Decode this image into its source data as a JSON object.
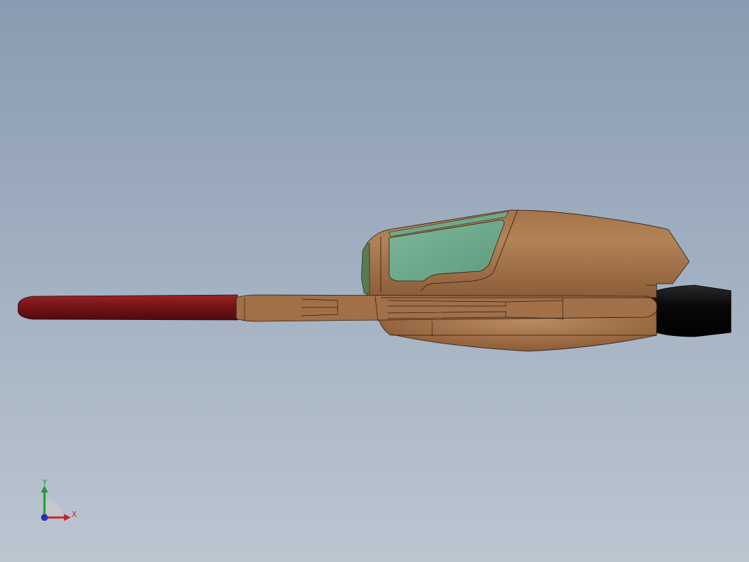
{
  "viewport": {
    "background_top": "#8a9bb1",
    "background_bottom": "#bcc6d1"
  },
  "model": {
    "name_icon": "vehicle-3d-model-icon",
    "colors": {
      "body": "#9b6b44",
      "body_highlight": "#b38358",
      "body_shadow": "#7d5433",
      "canopy": "#6fa88c",
      "canopy_dark": "#4e8468",
      "nose": "#7a1518",
      "nose_highlight": "#a02a2a",
      "exhaust": "#0a0a0a",
      "outline": "#2a1a0e"
    }
  },
  "triad": {
    "x_label": "X",
    "y_label": "Y",
    "x_color": "#c0282d",
    "y_color": "#1e9b2e",
    "z_color": "#2233bb"
  }
}
